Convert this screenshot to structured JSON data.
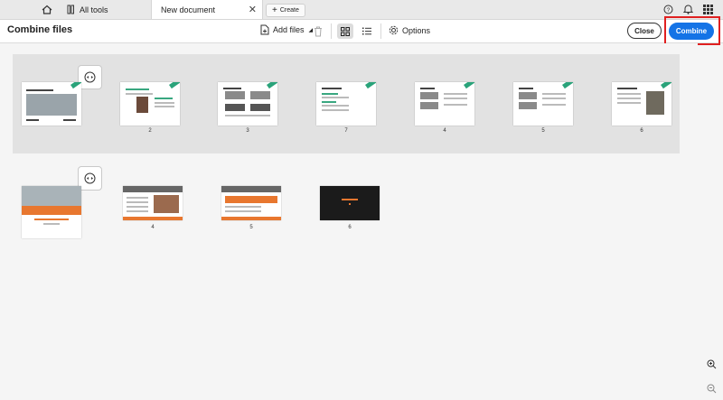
{
  "tabs": {
    "tools_label": "All tools",
    "document_label": "New document",
    "create_label": "Create"
  },
  "toolbar": {
    "title": "Combine files",
    "add_files_label": "Add files",
    "options_label": "Options",
    "close_label": "Close",
    "combine_label": "Combine"
  },
  "file_groups": [
    {
      "pages": [
        {
          "number": "",
          "first": true
        },
        {
          "number": "2"
        },
        {
          "number": "3"
        },
        {
          "number": "7"
        },
        {
          "number": "4"
        },
        {
          "number": "5"
        },
        {
          "number": "6"
        }
      ]
    },
    {
      "pages": [
        {
          "number": "",
          "first": true
        },
        {
          "number": "4"
        },
        {
          "number": "5"
        },
        {
          "number": "6"
        }
      ]
    }
  ],
  "colors": {
    "accent": "#1473e6",
    "highlight_outline": "#e02020",
    "slide_green": "#2aa37a",
    "slide_orange": "#e8772f"
  },
  "icons": [
    "home-icon",
    "tools-icon",
    "close-icon",
    "plus-icon",
    "help-icon",
    "bell-icon",
    "apps-grid-icon",
    "add-file-icon",
    "trash-icon",
    "grid-view-icon",
    "list-view-icon",
    "gear-icon",
    "expand-icon",
    "zoom-in-icon",
    "zoom-out-icon"
  ]
}
